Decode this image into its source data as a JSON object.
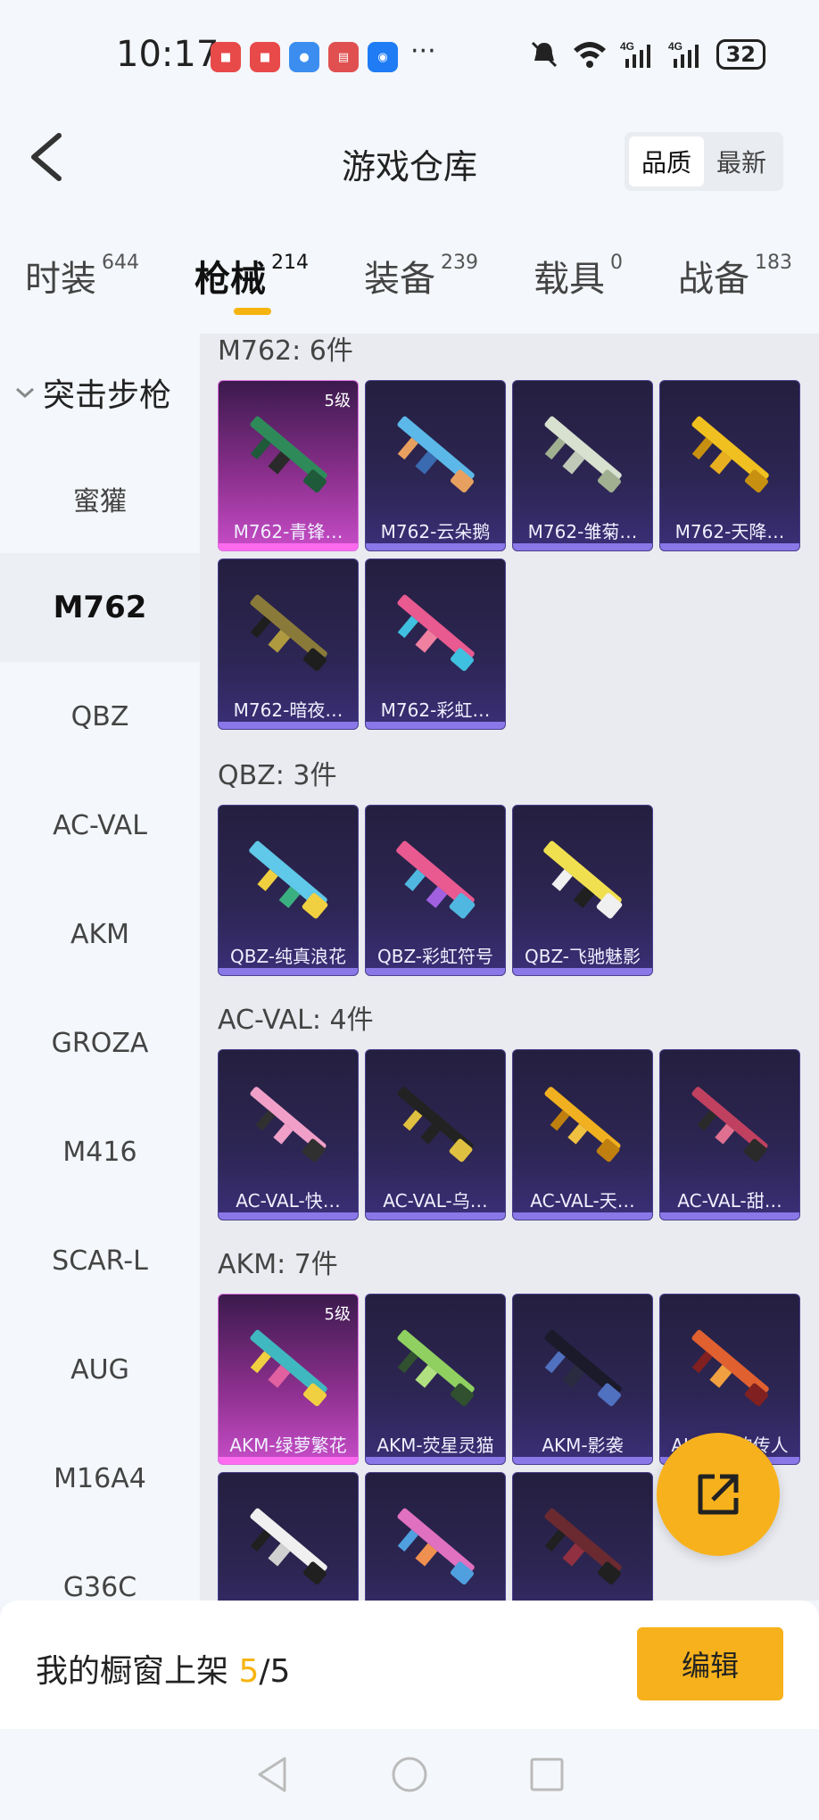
{
  "status": {
    "time": "10:17",
    "battery": "32",
    "more": "···"
  },
  "header": {
    "title": "游戏仓库",
    "sort_quality": "品质",
    "sort_newest": "最新"
  },
  "tabs": [
    {
      "label": "时装",
      "count": "644"
    },
    {
      "label": "枪械",
      "count": "214"
    },
    {
      "label": "装备",
      "count": "239"
    },
    {
      "label": "载具",
      "count": "0"
    },
    {
      "label": "战备",
      "count": "183"
    }
  ],
  "sidebar": {
    "category": "突击步枪",
    "items": [
      "蜜獾",
      "M762",
      "QBZ",
      "AC-VAL",
      "AKM",
      "GROZA",
      "M416",
      "SCAR-L",
      "AUG",
      "M16A4",
      "G36C"
    ]
  },
  "sections": [
    {
      "title": "M762: 6件",
      "items": [
        "M762-青锋…",
        "M762-云朵鹅",
        "M762-雏菊…",
        "M762-天降…",
        "M762-暗夜…",
        "M762-彩虹…"
      ],
      "level_badge": "5级"
    },
    {
      "title": "QBZ: 3件",
      "items": [
        "QBZ-纯真浪花",
        "QBZ-彩虹符号",
        "QBZ-飞驰魅影"
      ]
    },
    {
      "title": "AC-VAL: 4件",
      "items": [
        "AC-VAL-快…",
        "AC-VAL-乌…",
        "AC-VAL-天…",
        "AC-VAL-甜…"
      ]
    },
    {
      "title": "AKM: 7件",
      "items": [
        "AKM-绿萝繁花",
        "AKM-荧星灵猫",
        "AKM-影袭",
        "AKM-…的传人"
      ],
      "level_badge": "5级"
    }
  ],
  "bottom": {
    "shelf_label": "我的橱窗上架",
    "shelf_used": "5",
    "shelf_total": "/5",
    "edit_label": "编辑"
  },
  "colors": {
    "accent": "#f7b11c",
    "card_purple": "#2d2654",
    "card_gold": "#c84dc8"
  }
}
